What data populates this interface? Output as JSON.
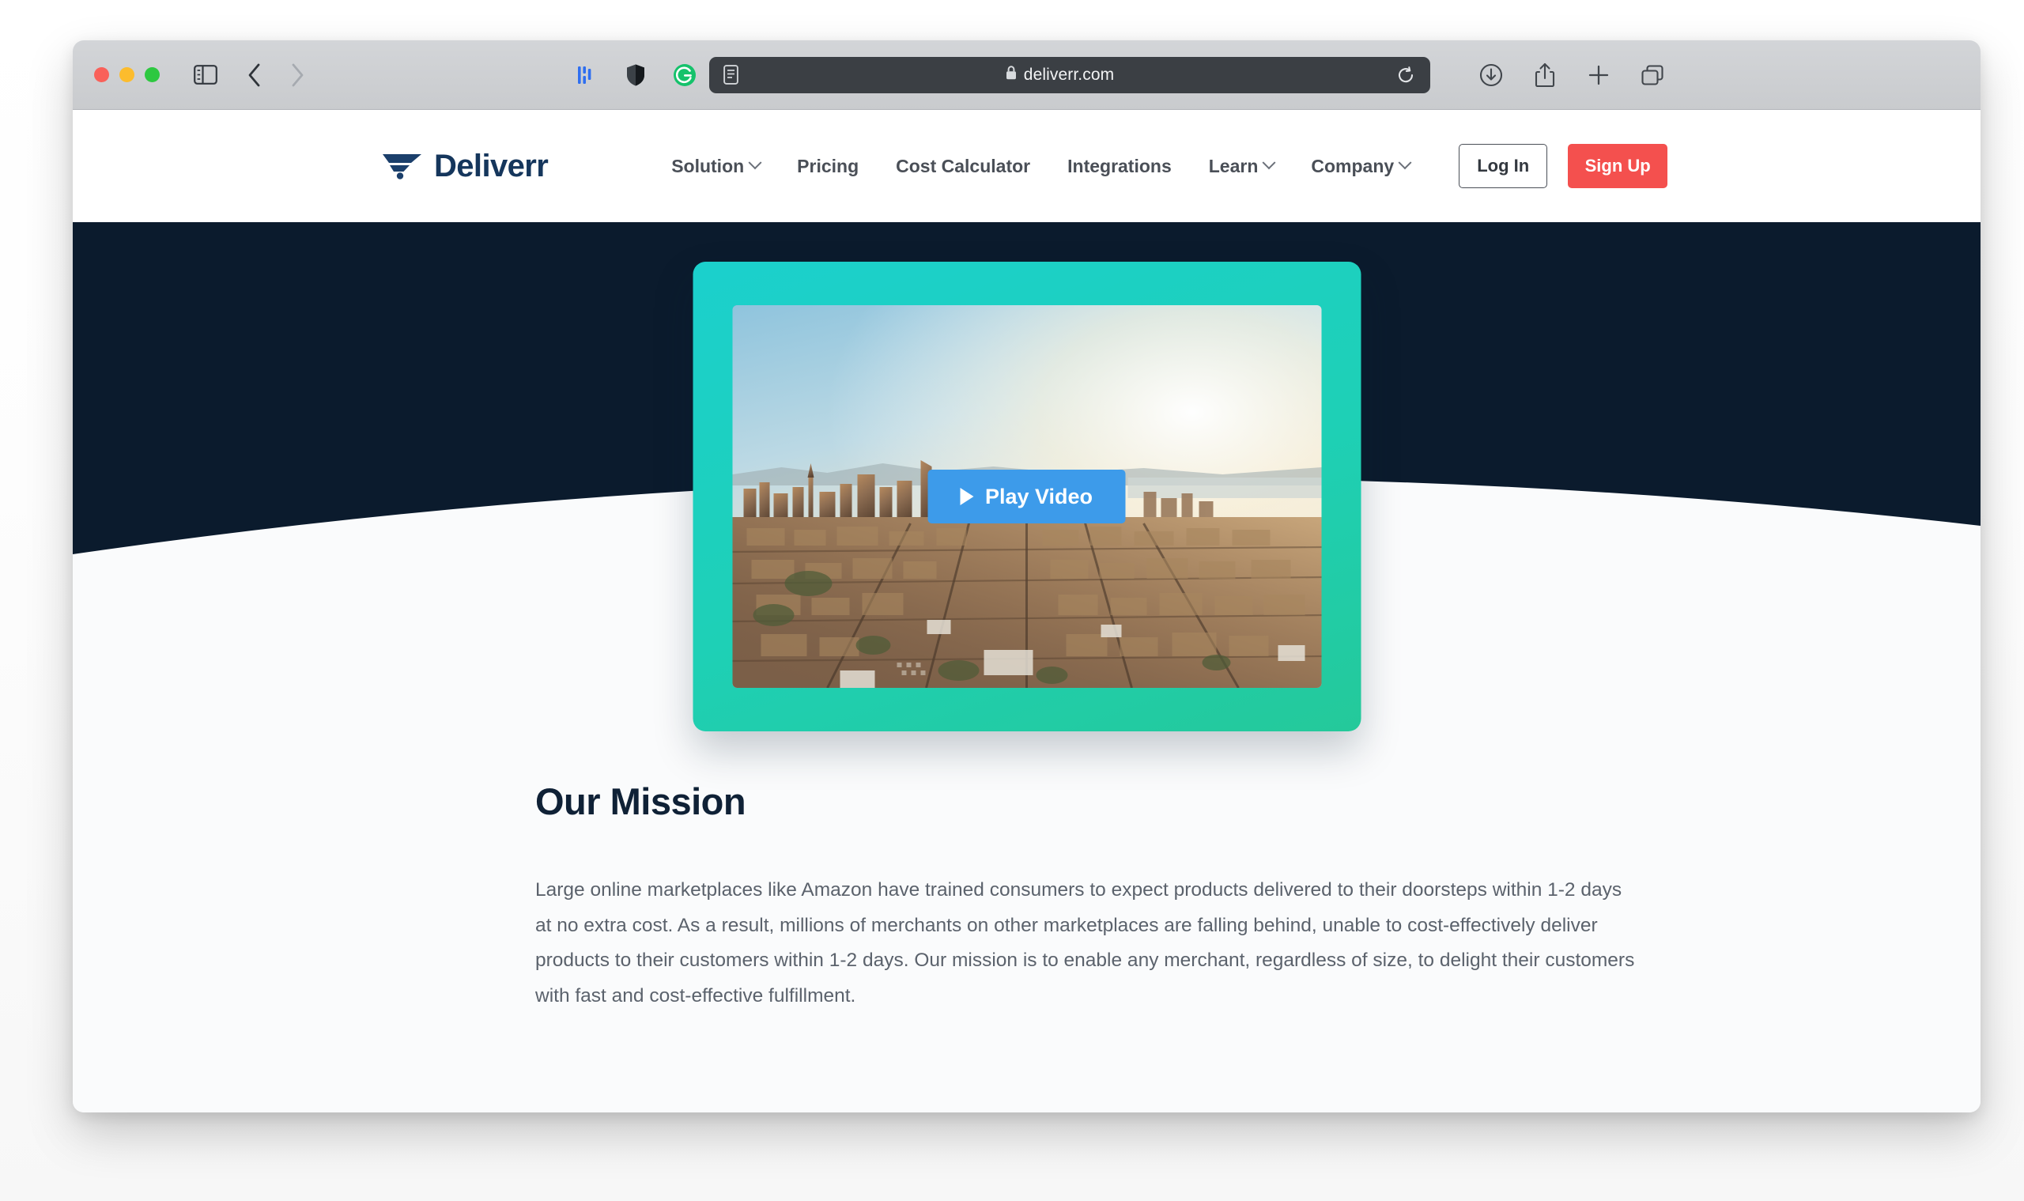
{
  "browser": {
    "traffic_lights": [
      "close",
      "minimize",
      "maximize"
    ],
    "sidebar_icon": "sidebar-icon",
    "back_icon": "chevron-left-icon",
    "forward_icon": "chevron-right-icon",
    "extensions": [
      {
        "name": "honey-extension-icon"
      },
      {
        "name": "shield-extension-icon"
      },
      {
        "name": "grammarly-extension-icon"
      }
    ],
    "url": {
      "reader_icon": "reader-view-icon",
      "lock_icon": "lock-icon",
      "text": "deliverr.com",
      "reload_icon": "reload-icon"
    },
    "right_icons": [
      {
        "name": "downloads-icon"
      },
      {
        "name": "share-icon"
      },
      {
        "name": "new-tab-icon"
      },
      {
        "name": "tab-overview-icon"
      }
    ]
  },
  "site": {
    "logo": {
      "text": "Deliverr",
      "icon": "deliverr-mark-icon",
      "color": "#15365c"
    },
    "nav": [
      {
        "label": "Solution",
        "has_dropdown": true
      },
      {
        "label": "Pricing",
        "has_dropdown": false
      },
      {
        "label": "Cost Calculator",
        "has_dropdown": false
      },
      {
        "label": "Integrations",
        "has_dropdown": false
      },
      {
        "label": "Learn",
        "has_dropdown": true
      },
      {
        "label": "Company",
        "has_dropdown": true
      }
    ],
    "auth": {
      "login_label": "Log In",
      "signup_label": "Sign Up",
      "signup_color": "#f4504e"
    }
  },
  "hero": {
    "background_color": "#0b1b2d",
    "video_frame_color": "#1bd0cd",
    "play_button": {
      "label": "Play Video",
      "icon": "play-icon",
      "color": "#3d9bea"
    },
    "thumbnail_alt": "Aerial view of San Francisco cityscape at sunset"
  },
  "mission": {
    "title": "Our Mission",
    "body": "Large online marketplaces like Amazon have trained consumers to expect products delivered to their doorsteps within 1-2 days at no extra cost. As a result, millions of merchants on other marketplaces are falling behind, unable to cost-effectively deliver products to their customers within 1-2 days. Our mission is to enable any merchant, regardless of size, to delight their customers with fast and cost-effective fulfillment."
  }
}
